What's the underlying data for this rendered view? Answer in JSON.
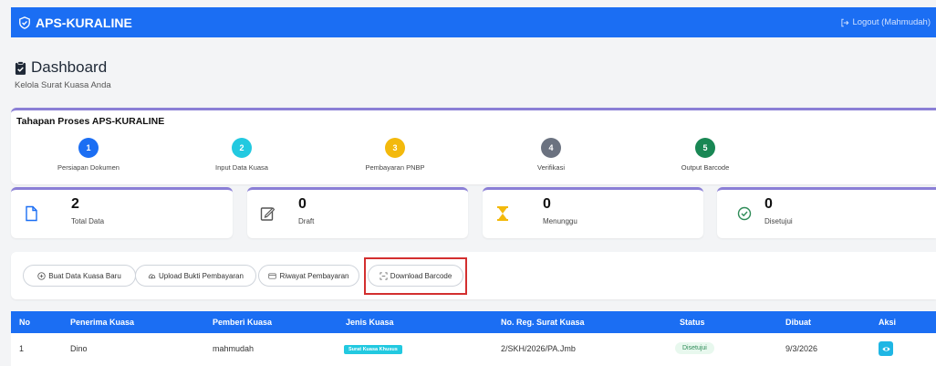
{
  "app": {
    "title": "APS-KURALINE",
    "logout_label": "Logout (Mahmudah)"
  },
  "page": {
    "title": "Dashboard",
    "subtitle": "Kelola Surat Kuasa Anda"
  },
  "stages": {
    "title": "Tahapan Proses APS-KURALINE",
    "items": [
      {
        "number": "1",
        "label": "Persiapan Dokumen",
        "color": "#1b6ef3"
      },
      {
        "number": "2",
        "label": "Input Data Kuasa",
        "color": "#22c9e0"
      },
      {
        "number": "3",
        "label": "Pembayaran PNBP",
        "color": "#f3b90c"
      },
      {
        "number": "4",
        "label": "Verifikasi",
        "color": "#6b7280"
      },
      {
        "number": "5",
        "label": "Output Barcode",
        "color": "#198754"
      }
    ]
  },
  "stats": [
    {
      "value": "2",
      "label": "Total Data",
      "icon": "file-icon"
    },
    {
      "value": "0",
      "label": "Draft",
      "icon": "edit-icon"
    },
    {
      "value": "0",
      "label": "Menunggu",
      "icon": "hourglass-icon"
    },
    {
      "value": "0",
      "label": "Disetujui",
      "icon": "check-circle-icon"
    }
  ],
  "actions": {
    "buat": "Buat Data Kuasa Baru",
    "upload": "Upload Bukti Pembayaran",
    "riwayat": "Riwayat Pembayaran",
    "download": "Download Barcode"
  },
  "table": {
    "columns": [
      "No",
      "Penerima Kuasa",
      "Pemberi Kuasa",
      "Jenis Kuasa",
      "No. Reg. Surat Kuasa",
      "Status",
      "Dibuat",
      "Aksi"
    ],
    "rows": [
      {
        "no": "1",
        "penerima": "Dino",
        "pemberi": "mahmudah",
        "jenis": "Surat Kuasa Khusus",
        "noreg": "2/SKH/2026/PA.Jmb",
        "status": "Disetujui",
        "dibuat": "9/3/2026"
      }
    ]
  },
  "colors": {
    "primary": "#1b6ef3",
    "accent": "#8b7fd6",
    "highlight": "#d32f2f",
    "success": "#2e8b57"
  }
}
